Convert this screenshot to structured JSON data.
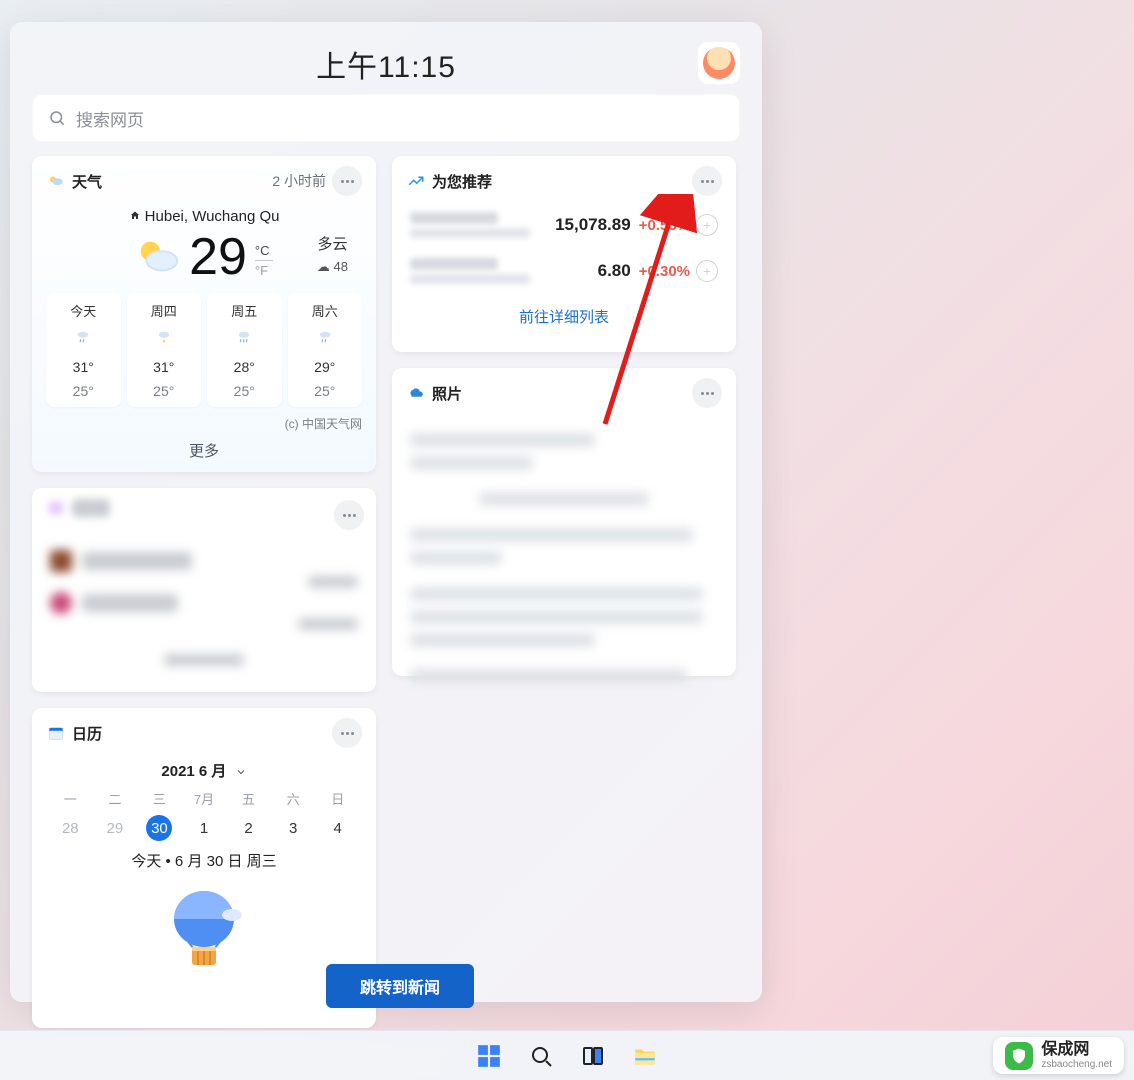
{
  "panel": {
    "clock": "上午11:15",
    "search_placeholder": "搜索网页"
  },
  "weather": {
    "title": "天气",
    "updated": "2 小时前",
    "location": "Hubei, Wuchang Qu",
    "temp": "29",
    "unit_c": "°C",
    "unit_f": "°F",
    "condition": "多云",
    "aqi": "☁ 48",
    "forecast": [
      {
        "label": "今天",
        "hi": "31°",
        "lo": "25°"
      },
      {
        "label": "周四",
        "hi": "31°",
        "lo": "25°"
      },
      {
        "label": "周五",
        "hi": "28°",
        "lo": "25°"
      },
      {
        "label": "周六",
        "hi": "29°",
        "lo": "25°"
      }
    ],
    "source": "(c) 中国天气网",
    "more": "更多"
  },
  "calendar": {
    "title": "日历",
    "month": "2021 6 月",
    "dow": [
      "一",
      "二",
      "三",
      "7月",
      "五",
      "六",
      "日"
    ],
    "days": [
      {
        "n": "28",
        "off": true
      },
      {
        "n": "29",
        "off": true
      },
      {
        "n": "30",
        "today": true
      },
      {
        "n": "1"
      },
      {
        "n": "2"
      },
      {
        "n": "3"
      },
      {
        "n": "4"
      }
    ],
    "today_line": "今天 • 6 月 30 日 周三"
  },
  "recommend": {
    "title": "为您推荐",
    "rows": [
      {
        "value": "15,078.89",
        "change": "+0.53%"
      },
      {
        "value": "6.80",
        "change": "+0.30%"
      }
    ],
    "link": "前往详细列表"
  },
  "photos": {
    "title": "照片"
  },
  "jump_button": "跳转到新闻",
  "watermark": {
    "name": "保成网",
    "domain": "zsbaocheng.net"
  }
}
